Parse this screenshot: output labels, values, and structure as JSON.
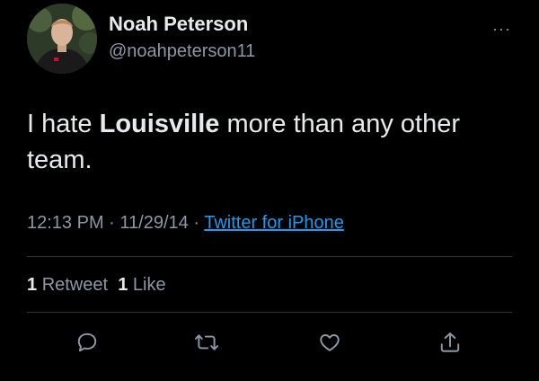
{
  "user": {
    "name": "Noah Peterson",
    "handle": "@noahpeterson11"
  },
  "menu": {
    "more_label": "···"
  },
  "tweet": {
    "text_before": "I hate ",
    "text_bold": "Louisville",
    "text_after": " more than any other team."
  },
  "meta": {
    "time": "12:13 PM",
    "separator": "·",
    "date": "11/29/14",
    "source": "Twitter for iPhone"
  },
  "stats": {
    "retweet_count": "1",
    "retweet_label": "Retweet",
    "like_count": "1",
    "like_label": "Like"
  },
  "actions": {
    "reply_icon": "reply-icon",
    "retweet_icon": "retweet-icon",
    "like_icon": "heart-icon",
    "share_icon": "share-icon"
  },
  "colors": {
    "background": "#000000",
    "text": "#e7e9ea",
    "secondary": "#8b98a5",
    "link": "#1d9bf0",
    "divider": "#2f3336"
  }
}
